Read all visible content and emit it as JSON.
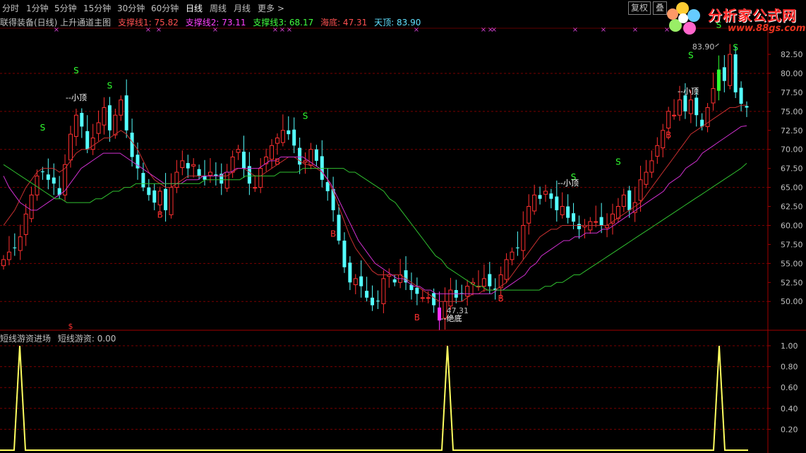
{
  "toolbar": {
    "periods": [
      "分时",
      "1分钟",
      "5分钟",
      "15分钟",
      "30分钟",
      "60分钟",
      "日线",
      "周线",
      "月线",
      "更多 >"
    ],
    "active": "日线",
    "buttons": [
      "复权",
      "叠"
    ]
  },
  "logo": {
    "text": "分析家公式网",
    "url": "www.88gs.com",
    "icon": "flower-logo-icon"
  },
  "info": {
    "title": "联得装备(日线) 上升通道主图",
    "items": [
      {
        "label": "支撑线1: 75.82",
        "color": "#ff5050"
      },
      {
        "label": "支撑线2: 73.11",
        "color": "#ff40ff"
      },
      {
        "label": "支撑线3: 68.17",
        "color": "#40ff40"
      },
      {
        "label": "海底: 47.31",
        "color": "#ff5050"
      },
      {
        "label": "天顶: 83.90",
        "color": "#60e0ff"
      }
    ]
  },
  "sub_panel": {
    "title": "短线游资进场",
    "value_label": "短线游资: 0.00"
  },
  "annotations": {
    "high_label": "83.90",
    "low_label": "47.31",
    "low_text": "--绝底",
    "top_text_1": "--小顶",
    "top_text_2": "--小顶",
    "top_text_3": "--小顶",
    "dollar_sign": "$",
    "buy_letter": "B",
    "sell_letter": "S"
  },
  "chart_data": [
    {
      "type": "candlestick",
      "title": "联得装备(日线) 上升通道主图",
      "y_ticks": [
        50.0,
        52.5,
        55.0,
        57.5,
        60.0,
        62.5,
        65.0,
        67.5,
        70.0,
        72.5,
        75.0,
        77.5,
        80.0,
        82.5
      ],
      "ylim": [
        47.0,
        85.0
      ],
      "high": 83.9,
      "low": 47.31,
      "closes": [
        55.5,
        56.5,
        57.0,
        58.5,
        61.5,
        64.0,
        66.5,
        67.0,
        66.0,
        65.5,
        64.0,
        68.0,
        72.0,
        74.5,
        73.0,
        70.0,
        71.5,
        73.5,
        75.5,
        72.5,
        74.5,
        76.5,
        72.5,
        69.0,
        67.5,
        65.0,
        64.0,
        63.0,
        64.5,
        62.0,
        65.0,
        67.0,
        68.5,
        67.5,
        68.0,
        66.5,
        66.0,
        67.0,
        66.5,
        65.5,
        67.0,
        69.0,
        70.0,
        67.5,
        65.5,
        65.0,
        67.5,
        69.0,
        70.5,
        71.5,
        72.5,
        72.0,
        70.5,
        68.0,
        68.5,
        70.0,
        68.5,
        66.0,
        64.5,
        62.0,
        58.0,
        54.5,
        52.5,
        53.0,
        52.0,
        50.5,
        49.5,
        50.0,
        53.0,
        53.5,
        52.5,
        53.5,
        52.5,
        51.5,
        51.0,
        50.5,
        50.5,
        49.5,
        47.5,
        50.0,
        51.5,
        50.5,
        51.0,
        52.0,
        52.5,
        52.0,
        53.0,
        52.0,
        51.5,
        53.5,
        55.5,
        56.5,
        57.0,
        60.0,
        62.5,
        64.0,
        63.5,
        64.5,
        63.5,
        62.0,
        62.5,
        61.0,
        60.5,
        59.5,
        60.0,
        60.5,
        60.5,
        60.0,
        60.0,
        61.5,
        62.5,
        64.0,
        62.0,
        63.0,
        66.0,
        67.0,
        68.5,
        70.5,
        72.5,
        75.0,
        74.5,
        76.5,
        75.0,
        76.5,
        74.5,
        73.0,
        75.5,
        78.0,
        80.5,
        79.0,
        82.5,
        77.5,
        76.0,
        75.5
      ],
      "series": [
        {
          "name": "支撑线1",
          "color": "#c83030",
          "values": [
            60.0,
            61.0,
            62.0,
            63.5,
            65.0,
            66.0,
            67.0,
            67.5,
            67.5,
            67.5,
            67.0,
            67.5,
            68.5,
            69.5,
            70.0,
            70.0,
            70.5,
            71.0,
            71.5,
            71.5,
            72.0,
            72.5,
            72.0,
            71.0,
            70.0,
            68.5,
            67.0,
            66.0,
            65.5,
            65.0,
            65.0,
            65.5,
            66.0,
            66.5,
            66.5,
            66.5,
            66.5,
            66.5,
            66.5,
            66.5,
            66.5,
            67.0,
            67.5,
            67.5,
            67.0,
            66.5,
            66.5,
            67.0,
            67.5,
            68.0,
            68.5,
            69.0,
            69.0,
            68.5,
            68.0,
            68.0,
            67.5,
            67.0,
            66.0,
            64.5,
            62.5,
            60.5,
            58.5,
            57.0,
            56.0,
            55.0,
            54.0,
            53.5,
            53.5,
            53.5,
            53.5,
            53.5,
            53.0,
            52.5,
            52.0,
            51.5,
            51.0,
            50.5,
            50.0,
            50.0,
            50.0,
            50.0,
            50.0,
            50.5,
            51.0,
            51.0,
            51.5,
            51.5,
            51.5,
            52.0,
            52.5,
            53.5,
            54.5,
            55.5,
            56.5,
            57.5,
            58.5,
            59.0,
            59.5,
            59.5,
            60.0,
            60.0,
            60.0,
            60.0,
            60.0,
            60.0,
            60.0,
            60.0,
            60.0,
            60.5,
            61.0,
            61.5,
            62.0,
            62.5,
            63.0,
            64.0,
            65.0,
            66.0,
            67.0,
            68.0,
            69.0,
            70.0,
            71.0,
            72.0,
            72.5,
            73.0,
            73.5,
            74.0,
            74.5,
            75.0,
            75.5,
            75.5,
            75.8,
            75.82
          ]
        },
        {
          "name": "支撑线2",
          "color": "#d030d0",
          "values": [
            66.5,
            65.0,
            64.0,
            63.0,
            62.5,
            62.0,
            62.0,
            62.5,
            63.0,
            63.5,
            64.0,
            64.5,
            65.5,
            66.5,
            67.5,
            68.0,
            68.5,
            69.0,
            69.5,
            69.5,
            69.5,
            69.5,
            69.0,
            68.5,
            68.0,
            67.5,
            67.0,
            66.5,
            66.0,
            65.5,
            65.5,
            65.5,
            65.5,
            66.0,
            66.0,
            66.0,
            66.5,
            66.5,
            66.5,
            66.5,
            67.0,
            67.0,
            67.5,
            67.5,
            67.5,
            67.5,
            67.5,
            68.0,
            68.5,
            68.5,
            69.0,
            69.0,
            69.0,
            69.0,
            69.0,
            68.5,
            68.0,
            67.5,
            66.5,
            65.5,
            64.0,
            62.5,
            61.0,
            59.5,
            58.0,
            57.0,
            56.0,
            55.0,
            54.5,
            54.0,
            53.5,
            53.0,
            53.0,
            52.5,
            52.0,
            52.0,
            51.5,
            51.5,
            51.0,
            51.0,
            51.0,
            51.0,
            51.0,
            51.0,
            51.0,
            51.0,
            51.0,
            51.0,
            51.0,
            51.5,
            51.5,
            52.0,
            52.5,
            53.0,
            53.5,
            54.5,
            55.0,
            56.0,
            56.5,
            57.0,
            57.5,
            58.0,
            58.0,
            58.5,
            58.5,
            59.0,
            59.0,
            59.0,
            59.5,
            59.5,
            60.0,
            60.5,
            61.0,
            61.5,
            62.0,
            62.5,
            63.0,
            63.5,
            64.0,
            64.5,
            65.5,
            66.0,
            66.5,
            67.5,
            68.0,
            68.5,
            69.5,
            70.0,
            70.5,
            71.0,
            71.5,
            72.0,
            72.5,
            73.0,
            73.11
          ]
        },
        {
          "name": "支撑线3",
          "color": "#30c030",
          "values": [
            68.0,
            67.5,
            67.0,
            66.5,
            66.0,
            65.5,
            65.0,
            64.5,
            64.0,
            63.5,
            63.5,
            63.0,
            63.0,
            63.0,
            63.0,
            63.0,
            63.5,
            63.5,
            64.0,
            64.5,
            64.5,
            65.0,
            65.0,
            65.5,
            65.5,
            65.5,
            65.5,
            65.5,
            65.5,
            65.5,
            65.5,
            65.5,
            65.5,
            65.5,
            65.5,
            66.0,
            66.0,
            66.0,
            66.0,
            66.0,
            66.0,
            66.0,
            66.5,
            66.5,
            66.5,
            66.5,
            66.5,
            66.5,
            67.0,
            67.0,
            67.0,
            67.0,
            67.5,
            67.5,
            67.5,
            67.5,
            67.5,
            67.5,
            67.5,
            67.5,
            67.0,
            67.0,
            66.5,
            66.0,
            65.5,
            65.0,
            64.5,
            63.5,
            63.0,
            62.0,
            61.0,
            60.0,
            59.0,
            58.0,
            57.0,
            56.0,
            55.5,
            54.5,
            54.0,
            53.5,
            53.0,
            52.5,
            52.0,
            52.0,
            51.5,
            51.5,
            51.5,
            51.5,
            51.5,
            51.5,
            51.5,
            51.5,
            51.5,
            51.5,
            52.0,
            52.0,
            52.5,
            52.5,
            53.0,
            53.5,
            53.5,
            54.0,
            54.5,
            55.0,
            55.5,
            56.0,
            56.5,
            57.0,
            57.5,
            58.0,
            58.5,
            59.0,
            59.5,
            60.0,
            60.5,
            61.0,
            61.5,
            62.0,
            62.5,
            63.0,
            63.5,
            64.0,
            64.5,
            65.0,
            65.5,
            66.0,
            66.5,
            67.0,
            67.5,
            68.17
          ]
        }
      ],
      "signals": [
        {
          "i": 7,
          "type": "S"
        },
        {
          "i": 13,
          "type": "S"
        },
        {
          "i": 19,
          "type": "S"
        },
        {
          "i": 54,
          "type": "S"
        },
        {
          "i": 102,
          "type": "S"
        },
        {
          "i": 110,
          "type": "S"
        },
        {
          "i": 123,
          "type": "S"
        },
        {
          "i": 128,
          "type": "S"
        },
        {
          "i": 131,
          "type": "S"
        },
        {
          "i": 137,
          "type": "S"
        },
        {
          "i": 28,
          "type": "B"
        },
        {
          "i": 49,
          "type": "B"
        },
        {
          "i": 59,
          "type": "B"
        },
        {
          "i": 74,
          "type": "B"
        },
        {
          "i": 89,
          "type": "B"
        },
        {
          "i": 119,
          "type": "B"
        }
      ]
    },
    {
      "type": "line",
      "title": "短线游资进场",
      "y_ticks": [
        0.2,
        0.4,
        0.6,
        0.8,
        1.0
      ],
      "ylim": [
        0,
        1.05
      ],
      "spikes_at": [
        2,
        89,
        144
      ],
      "value": 0.0
    }
  ]
}
